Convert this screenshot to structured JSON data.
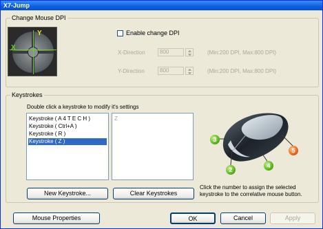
{
  "window": {
    "title": "X7-Jump"
  },
  "dpi": {
    "group_title": "Change Mouse DPI",
    "enable_label": "Enable change DPI",
    "x_label": "X-Direction",
    "x_value": "800",
    "x_range": "(Min:200 DPI, Max:800 DPI)",
    "y_label": "Y-Direction",
    "y_value": "800",
    "y_range": "(Min:200 DPI, Max:800 DPI)",
    "axis_x": "X",
    "axis_y": "Y"
  },
  "keystrokes": {
    "group_title": "Keystrokes",
    "instructions": "Double click a keystroke to modify it's settings",
    "items": [
      "Keystroke ( A 4 T E C H )",
      "Keystroke ( Ctrl+A )",
      "Keystroke ( R )",
      "Keystroke ( Z )"
    ],
    "selected_index": 3,
    "detail_value": "Z",
    "new_button": "New Keystroke...",
    "clear_button": "Clear Keystrokes",
    "note": "Click the number to assign the selected keystroke to the correlative mouse button.",
    "buttons": [
      {
        "number": "2",
        "color": "#5ab61c"
      },
      {
        "number": "3",
        "color": "#5ab61c"
      },
      {
        "number": "4",
        "color": "#5ab61c"
      },
      {
        "number": "5",
        "color": "#e86a1c"
      }
    ]
  },
  "footer": {
    "mouse_properties": "Mouse Properties",
    "ok": "OK",
    "cancel": "Cancel",
    "apply": "Apply"
  }
}
